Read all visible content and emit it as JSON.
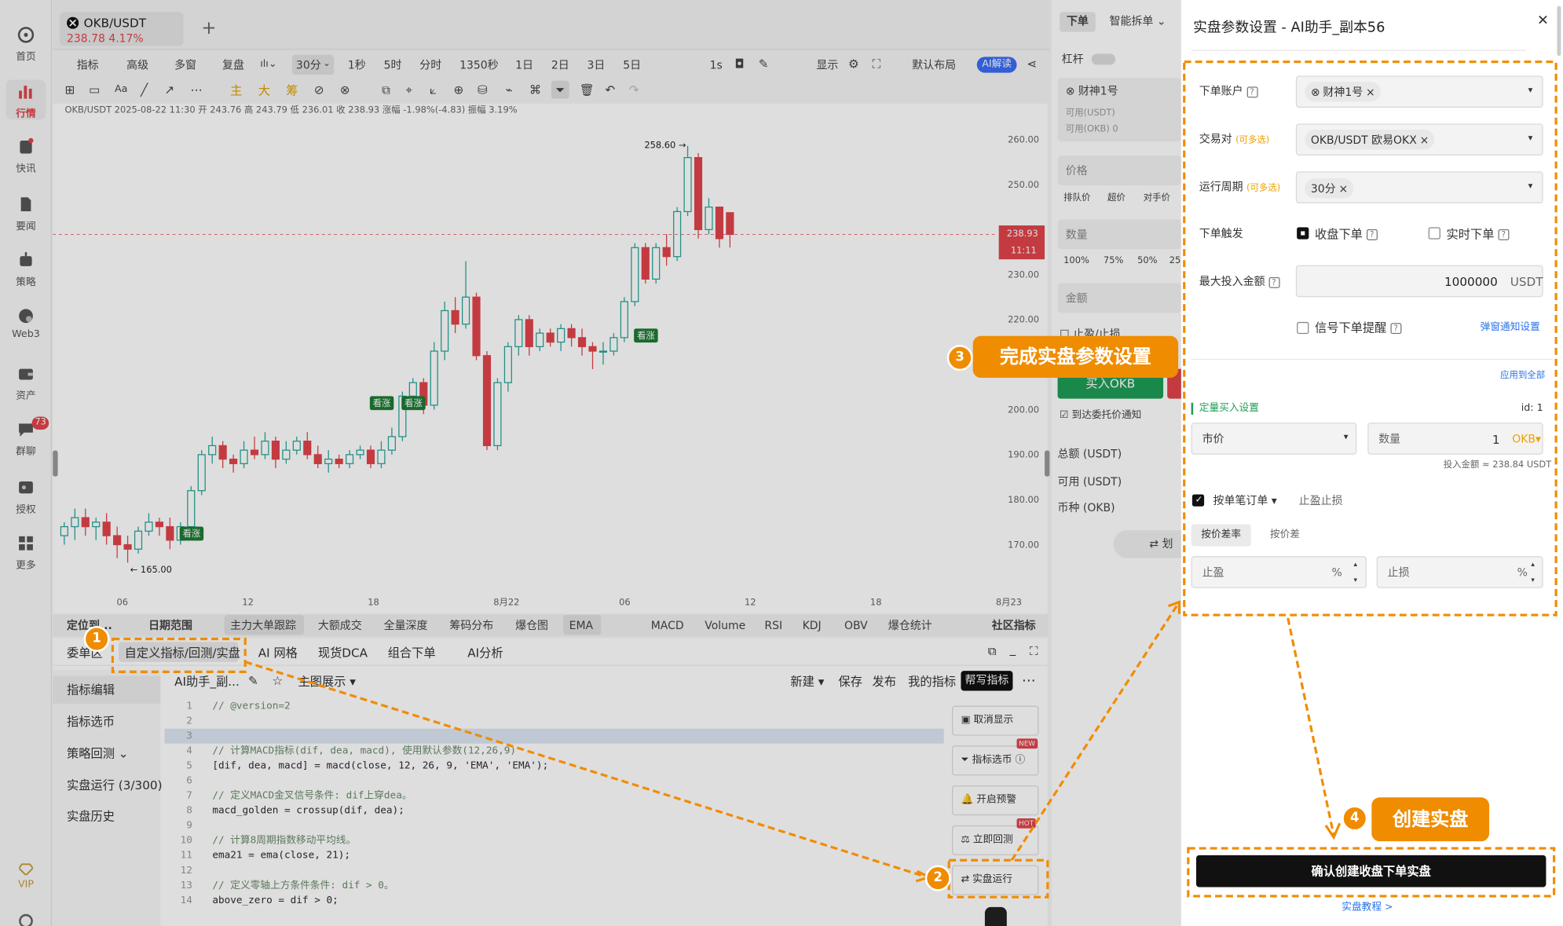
{
  "sidebar": {
    "items": [
      {
        "label": "首页"
      },
      {
        "label": "行情"
      },
      {
        "label": "快讯"
      },
      {
        "label": "要闻"
      },
      {
        "label": "策略"
      },
      {
        "label": "Web3"
      },
      {
        "label": "资产"
      },
      {
        "label": "群聊",
        "badge": "73"
      },
      {
        "label": "授权"
      },
      {
        "label": "更多"
      }
    ],
    "vip": "VIP"
  },
  "tab": {
    "symbol": "OKB/USDT",
    "price_change": "238.78  4.17%"
  },
  "toolbar1": {
    "items": [
      "指标",
      "高级",
      "多窗",
      "复盘"
    ],
    "interval": "30分",
    "intervals": [
      "1秒",
      "5时",
      "分时",
      "1350秒",
      "1日",
      "2日",
      "3日",
      "5日"
    ],
    "right": [
      "1s",
      "显示",
      "默认布局"
    ],
    "ai": "AI解读"
  },
  "drawbar": {
    "main": "主",
    "big": "大",
    "chip": "筹"
  },
  "info": {
    "line": "OKB/USDT  2025-08-22 11:30  开 243.76  高 243.79  低 236.01  收 238.93  涨幅 -1.98%(-4.83)  振幅 3.19%"
  },
  "chart_data": {
    "type": "candlestick",
    "symbol": "OKB/USDT",
    "interval": "30分",
    "ylim": [
      165,
      262
    ],
    "yticks": [
      "260.00",
      "250.00",
      "240.00",
      "230.00",
      "220.00",
      "210.00",
      "200.00",
      "190.00",
      "180.00",
      "170.00"
    ],
    "xticks": [
      "06",
      "12",
      "18",
      "8月22",
      "06",
      "12",
      "18",
      "8月23"
    ],
    "high_label": "258.60",
    "low_label": "165.00",
    "last_price": "238.93",
    "countdown": "11:11",
    "signals": [
      "看涨",
      "看涨",
      "看涨",
      "看涨"
    ],
    "candles": [
      [
        172,
        174,
        170,
        175
      ],
      [
        174,
        176,
        171,
        178
      ],
      [
        176,
        174,
        172,
        178
      ],
      [
        174,
        175,
        171,
        176
      ],
      [
        175,
        172,
        170,
        177
      ],
      [
        172,
        170,
        167,
        174
      ],
      [
        170,
        169,
        166,
        172
      ],
      [
        169,
        173,
        168,
        174
      ],
      [
        173,
        175,
        172,
        177
      ],
      [
        175,
        174,
        172,
        176
      ],
      [
        174,
        171,
        169,
        176
      ],
      [
        171,
        174,
        170,
        175
      ],
      [
        174,
        182,
        173,
        183
      ],
      [
        182,
        190,
        181,
        191
      ],
      [
        190,
        192,
        188,
        194
      ],
      [
        192,
        189,
        187,
        193
      ],
      [
        189,
        188,
        186,
        190
      ],
      [
        188,
        191,
        187,
        193
      ],
      [
        191,
        190,
        189,
        194
      ],
      [
        190,
        193,
        189,
        195
      ],
      [
        193,
        189,
        187,
        194
      ],
      [
        189,
        191,
        188,
        193
      ],
      [
        191,
        193,
        190,
        194
      ],
      [
        193,
        190,
        189,
        195
      ],
      [
        190,
        188,
        187,
        192
      ],
      [
        188,
        189,
        186,
        191
      ],
      [
        189,
        188,
        187,
        190
      ],
      [
        188,
        190,
        187,
        191
      ],
      [
        190,
        191,
        189,
        192
      ],
      [
        191,
        188,
        187,
        192
      ],
      [
        188,
        191,
        187,
        193
      ],
      [
        191,
        194,
        190,
        196
      ],
      [
        194,
        203,
        193,
        204
      ],
      [
        203,
        206,
        201,
        207
      ],
      [
        206,
        201,
        199,
        207
      ],
      [
        201,
        213,
        200,
        215
      ],
      [
        213,
        222,
        211,
        224
      ],
      [
        222,
        219,
        217,
        225
      ],
      [
        219,
        225,
        218,
        233
      ],
      [
        225,
        212,
        211,
        226
      ],
      [
        212,
        192,
        191,
        213
      ],
      [
        192,
        206,
        191,
        207
      ],
      [
        206,
        214,
        204,
        215
      ],
      [
        214,
        220,
        212,
        221
      ],
      [
        220,
        214,
        212,
        221
      ],
      [
        214,
        217,
        213,
        218
      ],
      [
        217,
        215,
        214,
        218
      ],
      [
        215,
        218,
        213,
        219
      ],
      [
        218,
        216,
        214,
        219
      ],
      [
        216,
        214,
        212,
        218
      ],
      [
        214,
        213,
        209,
        215
      ],
      [
        213,
        213,
        210,
        215
      ],
      [
        213,
        216,
        212,
        217
      ],
      [
        216,
        224,
        215,
        225
      ],
      [
        224,
        236,
        223,
        237
      ],
      [
        236,
        229,
        228,
        237
      ],
      [
        229,
        236,
        228,
        237
      ],
      [
        236,
        234,
        232,
        239
      ],
      [
        234,
        244,
        233,
        245
      ],
      [
        244,
        256,
        243,
        258.6
      ],
      [
        256,
        240,
        238,
        257
      ],
      [
        240,
        245,
        239,
        247
      ],
      [
        245,
        238,
        236,
        245
      ],
      [
        243.76,
        238.93,
        236.01,
        243.79
      ]
    ]
  },
  "bottom_bar": {
    "items": [
      "定位到...",
      "日期范围",
      "主力大单跟踪",
      "大额成交",
      "全量深度",
      "筹码分布",
      "爆仓图",
      "EMA",
      "MACD",
      "Volume",
      "RSI",
      "KDJ",
      "OBV",
      "爆仓统计",
      "社区指标"
    ]
  },
  "panel_tabs": [
    "委单区",
    "自定义指标/回测/实盘",
    "AI 网格",
    "现货DCA",
    "组合下单",
    "AI分析"
  ],
  "left_menu": [
    "指标编辑",
    "指标选币",
    "策略回测",
    "实盘运行 (3/300)",
    "实盘历史"
  ],
  "editor": {
    "title": "AI助手_副...",
    "mode": "主图展示",
    "actions": [
      "新建",
      "保存",
      "发布",
      "我的指标",
      "帮写指标"
    ],
    "lines": [
      {
        "n": "1",
        "c": "// @version=2",
        "k": "c"
      },
      {
        "n": "2",
        "c": "",
        "k": "p"
      },
      {
        "n": "3",
        "c": "",
        "k": "p"
      },
      {
        "n": "4",
        "c": "// 计算MACD指标(dif, dea, macd), 使用默认参数(12,26,9)",
        "k": "c"
      },
      {
        "n": "5",
        "c": "[dif, dea, macd] = macd(close, 12, 26, 9, 'EMA', 'EMA');",
        "k": "p"
      },
      {
        "n": "6",
        "c": "",
        "k": "p"
      },
      {
        "n": "7",
        "c": "// 定义MACD金叉信号条件: dif上穿dea。",
        "k": "c"
      },
      {
        "n": "8",
        "c": "macd_golden = crossup(dif, dea);",
        "k": "p"
      },
      {
        "n": "9",
        "c": "",
        "k": "p"
      },
      {
        "n": "10",
        "c": "// 计算8周期指数移动平均线。",
        "k": "c"
      },
      {
        "n": "11",
        "c": "ema21 = ema(close, 21);",
        "k": "p"
      },
      {
        "n": "12",
        "c": "",
        "k": "p"
      },
      {
        "n": "13",
        "c": "// 定义零轴上方条件条件: dif > 0。",
        "k": "c"
      },
      {
        "n": "14",
        "c": "above_zero = dif > 0;",
        "k": "p"
      }
    ]
  },
  "side_buttons": [
    "取消显示",
    "指标选币",
    "开启预警",
    "立即回测",
    "实盘运行"
  ],
  "badges": {
    "new": "NEW",
    "hot": "HOT"
  },
  "order": {
    "tabs": [
      "下单",
      "智能拆单"
    ],
    "leverage": "杠杆",
    "account": "财神1号",
    "avail_usdt": "可用(USDT)",
    "avail_okb": "可用(OKB)  0",
    "price": "价格",
    "price_opts": [
      "排队价",
      "超价",
      "对手价"
    ],
    "qty": "数量",
    "pcts": [
      "100%",
      "75%",
      "50%",
      "25%"
    ],
    "amount": "金额",
    "stop": "止盈/止损",
    "buy": "买入OKB",
    "notify": "到达委托价通知",
    "totals": [
      "总额 (USDT)",
      "可用 (USDT)",
      "币种 (OKB)"
    ],
    "transfer": "划"
  },
  "modal": {
    "title": "实盘参数设置 - AI助手_副本56",
    "labels": {
      "account": "下单账户",
      "pair": "交易对",
      "pair_hint": "(可多选)",
      "period": "运行周期",
      "period_hint": "(可多选)",
      "trigger": "下单触发",
      "max": "最大投入金额"
    },
    "account_tag": "财神1号",
    "pair_tag": "OKB/USDT 欧易OKX",
    "period_tag": "30分",
    "close_order": "收盘下单",
    "rt_order": "实时下单",
    "max_value": "1000000",
    "max_unit": "USDT",
    "signal_remind": "信号下单提醒",
    "popup_link": "弹窗通知设置",
    "apply_all": "应用到全部",
    "buy_section": "定量买入设置",
    "id": "id: 1",
    "market": "市价",
    "qty_label": "数量",
    "qty_value": "1",
    "qty_unit": "OKB",
    "invest": "投入金额 ≈ 238.84 USDT",
    "order_mode": "按单笔订单",
    "tp_sl": "止盈止损",
    "diff_tabs": [
      "按价差率",
      "按价差"
    ],
    "tp": "止盈",
    "sl": "止损",
    "pct": "%",
    "confirm": "确认创建收盘下单实盘",
    "tutorial": "实盘教程 >"
  },
  "callouts": [
    {
      "n": "1"
    },
    {
      "n": "2"
    },
    {
      "n": "3",
      "text": "完成实盘参数设置"
    },
    {
      "n": "4",
      "text": "创建实盘"
    }
  ],
  "colors": {
    "up": "#26a69a",
    "down": "#e0444b",
    "accent": "#ff8a00",
    "dark": "#111111"
  }
}
